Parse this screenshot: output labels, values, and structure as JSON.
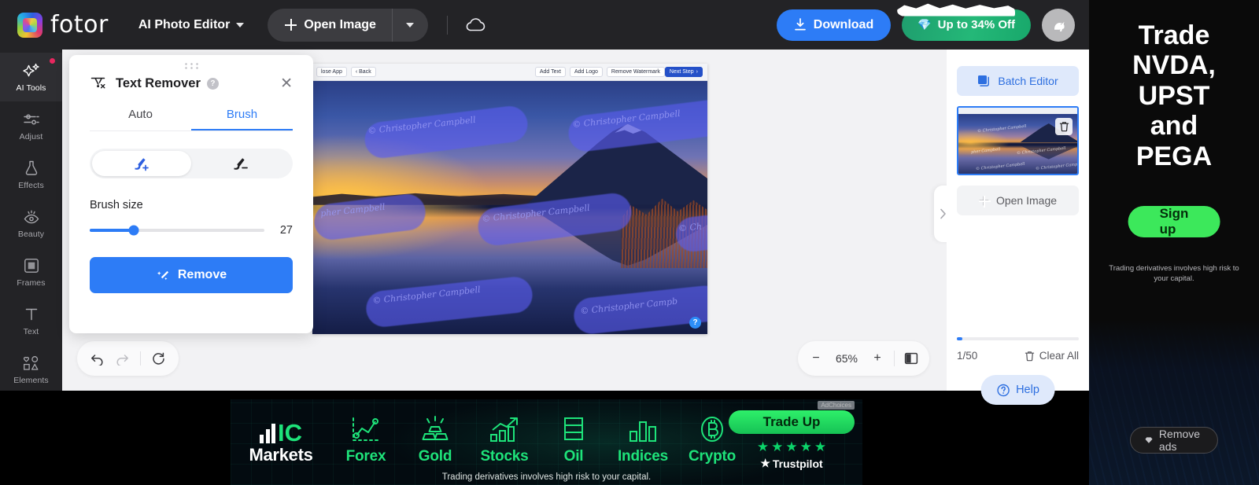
{
  "topbar": {
    "brand": "fotor",
    "product_dropdown": "AI Photo Editor",
    "open_image": "Open Image",
    "cloud_icon": "cloud-icon",
    "download": "Download",
    "promo": "Up to 34% Off",
    "avatar_icon": "bird-avatar-icon"
  },
  "rail": {
    "items": [
      {
        "label": "AI Tools",
        "icon": "sparkle-icon",
        "active": true,
        "badge": true
      },
      {
        "label": "Adjust",
        "icon": "sliders-icon",
        "active": false,
        "badge": false
      },
      {
        "label": "Effects",
        "icon": "flask-icon",
        "active": false,
        "badge": false
      },
      {
        "label": "Beauty",
        "icon": "eye-icon",
        "active": false,
        "badge": false
      },
      {
        "label": "Frames",
        "icon": "frame-icon",
        "active": false,
        "badge": false
      },
      {
        "label": "Text",
        "icon": "text-t-icon",
        "active": false,
        "badge": false
      },
      {
        "label": "Elements",
        "icon": "shapes-icon",
        "active": false,
        "badge": false
      }
    ]
  },
  "text_remover": {
    "title": "Text Remover",
    "help_icon": "question-mark-icon",
    "close_icon": "close-icon",
    "tabs": [
      {
        "label": "Auto",
        "active": false
      },
      {
        "label": "Brush",
        "active": true
      }
    ],
    "brush_modes": [
      {
        "icon": "brush-add-icon",
        "active": true
      },
      {
        "icon": "brush-erase-icon",
        "active": false
      }
    ],
    "brush_size_label": "Brush size",
    "brush_size_value": "27",
    "remove_button": "Remove",
    "remove_icon": "magic-wand-icon"
  },
  "canvas": {
    "inner_toolbar": {
      "close_app": "lose App",
      "back": "Back",
      "add_text": "Add Text",
      "add_logo": "Add Logo",
      "remove_watermark": "Remove Watermark",
      "next_step": "Next Step"
    },
    "watermarks": [
      "© Christopher Campbell",
      "© Christopher Campbell",
      "pher Campbell",
      "© Christopher Campbell",
      "© Ch",
      "© Christopher Campbell",
      "© Christopher Campb"
    ],
    "help_badge": "?"
  },
  "bottom_toolbar": {
    "undo_icon": "undo-arrow-icon",
    "redo_icon": "redo-arrow-icon",
    "reset_icon": "reset-circle-icon",
    "zoom_out": "−",
    "zoom_level": "65%",
    "zoom_in": "+",
    "compare_icon": "compare-split-icon"
  },
  "right_panel": {
    "batch_editor": "Batch Editor",
    "batch_icon": "layers-icon",
    "thumbnail_delete_icon": "trash-icon",
    "open_image": "Open Image",
    "counter": "1/50",
    "clear_all": "Clear All",
    "clear_all_icon": "trash-icon",
    "help": "Help",
    "help_icon": "question-circle-icon",
    "collapse_icon": "chevron-right-icon"
  },
  "right_ad": {
    "headline_lines": [
      "Trade",
      "NVDA,",
      "UPST",
      "and",
      "PEGA"
    ],
    "cta": "Sign up",
    "disclaimer": "Trading derivatives involves high risk to your capital.",
    "remove_ads": "Remove ads",
    "remove_ads_icon": "diamond-icon"
  },
  "bottom_ad": {
    "brand_ic": "IC",
    "brand_markets": "Markets",
    "items": [
      {
        "label": "Forex",
        "icon": "line-chart-icon"
      },
      {
        "label": "Gold",
        "icon": "gold-bars-icon"
      },
      {
        "label": "Stocks",
        "icon": "bar-chart-up-icon"
      },
      {
        "label": "Oil",
        "icon": "oil-barrel-icon"
      },
      {
        "label": "Indices",
        "icon": "bars-icon"
      },
      {
        "label": "Crypto",
        "icon": "bitcoin-icon"
      }
    ],
    "cta": "Trade Up",
    "trustpilot": "Trustpilot",
    "stars": 5,
    "disclaimer": "Trading derivatives involves high risk to your capital.",
    "adchoices": "AdChoices"
  },
  "colors": {
    "accent_blue": "#2d7cf6",
    "promo_green": "#24b878",
    "ad_green": "#3ce85b",
    "dark_chrome": "#232326"
  }
}
